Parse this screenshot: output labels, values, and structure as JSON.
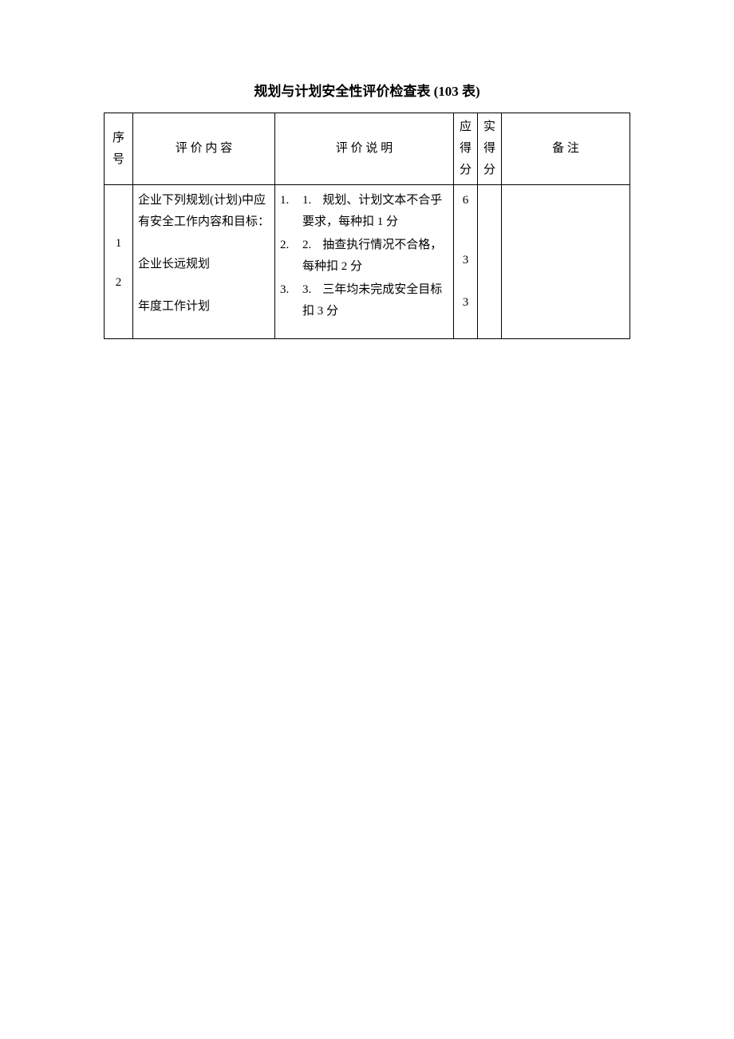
{
  "title": "规划与计划安全性评价检查表 (103 表)",
  "headers": {
    "seq": "序号",
    "content": "评 价 内 容",
    "desc": "评 价 说 明",
    "ying": "应得分",
    "shi": "实得分",
    "remark": "备    注"
  },
  "body": {
    "content_intro": "企业下列规划(计划)中应有安全工作内容和目标：",
    "rows": [
      {
        "seq": "1",
        "text": "企业长远规划",
        "score": "3"
      },
      {
        "seq": "2",
        "text": "年度工作计划",
        "score": "3"
      }
    ],
    "top_score": "6",
    "desc_items": [
      {
        "outer": "1.",
        "inner_num": "1.",
        "inner_text": "规划、计划文本不合乎要求，每种扣 1 分"
      },
      {
        "outer": "2.",
        "inner_num": "2.",
        "inner_text": "抽查执行情况不合格，每种扣 2 分"
      },
      {
        "outer": "3.",
        "inner_num": "3.",
        "inner_text": "三年均未完成安全目标扣 3 分"
      }
    ]
  }
}
